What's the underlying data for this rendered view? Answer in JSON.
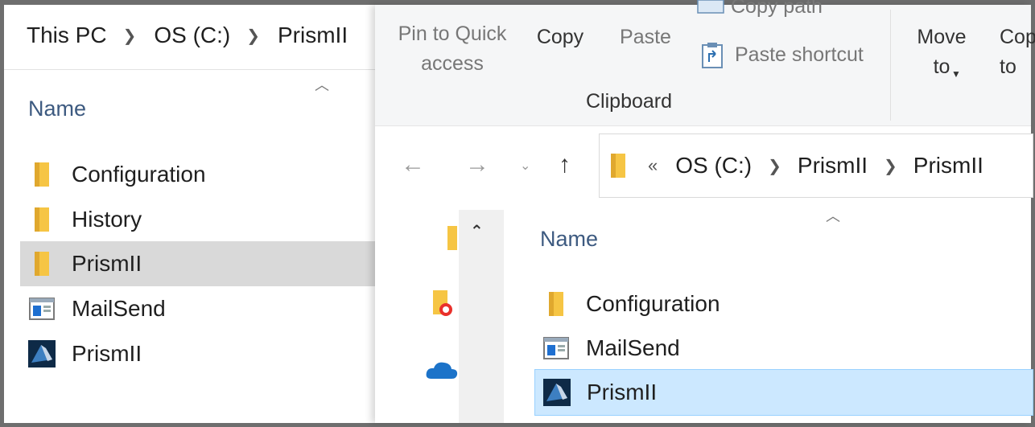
{
  "left_pane": {
    "breadcrumb": [
      "This PC",
      "OS (C:)",
      "PrismII"
    ],
    "column_header": "Name",
    "items": [
      {
        "name": "Configuration",
        "icon": "folder-icon",
        "selected": false
      },
      {
        "name": "History",
        "icon": "folder-icon",
        "selected": false
      },
      {
        "name": "PrismII",
        "icon": "folder-icon",
        "selected": true
      },
      {
        "name": "MailSend",
        "icon": "app-window-icon",
        "selected": false
      },
      {
        "name": "PrismII",
        "icon": "prism-app-icon",
        "selected": false
      }
    ]
  },
  "right_pane": {
    "ribbon": {
      "pin_to_quick_access": "Pin to Quick access",
      "copy": "Copy",
      "paste": "Paste",
      "copy_path": "Copy path",
      "paste_shortcut": "Paste shortcut",
      "group_label": "Clipboard",
      "move_to": "Move to",
      "copy_to": "Copy to"
    },
    "address_bar": {
      "overflow": "«",
      "segments": [
        "OS (C:)",
        "PrismII",
        "PrismII"
      ]
    },
    "column_header": "Name",
    "items": [
      {
        "name": "Configuration",
        "icon": "folder-icon",
        "selected": false
      },
      {
        "name": "MailSend",
        "icon": "app-window-icon",
        "selected": false
      },
      {
        "name": "PrismII",
        "icon": "prism-app-icon",
        "selected": true
      }
    ]
  },
  "colors": {
    "selection_grey": "#d9d9d9",
    "selection_blue": "#cce8ff",
    "folder_yellow": "#f6c544",
    "header_blue": "#3d5a80"
  }
}
